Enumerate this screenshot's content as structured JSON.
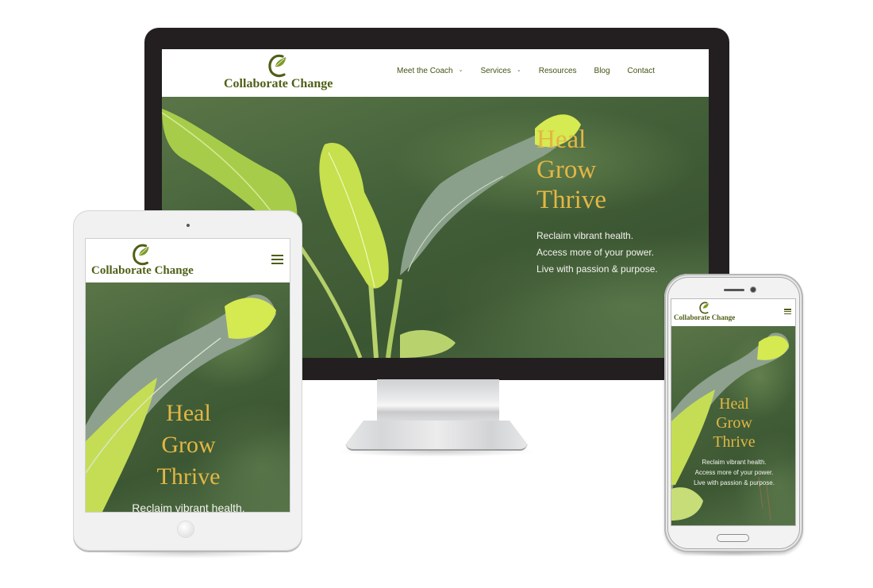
{
  "site": {
    "brand_name": "Collaborate Change",
    "logo_icon": "leaf-c-monogram-icon",
    "brand_color": "#4f5f17",
    "accent_color": "#e2b744"
  },
  "desktop": {
    "nav": [
      {
        "label": "Meet the Coach",
        "has_dropdown": true,
        "icon": "chevron-down-icon",
        "chev": "⌄"
      },
      {
        "label": "Services",
        "has_dropdown": true,
        "icon": "chevron-down-icon",
        "chev": "⌄"
      },
      {
        "label": "Resources",
        "has_dropdown": false
      },
      {
        "label": "Blog",
        "has_dropdown": false
      },
      {
        "label": "Contact",
        "has_dropdown": false
      }
    ]
  },
  "mobile": {
    "menu_icon": "hamburger-menu-icon"
  },
  "hero": {
    "headline": [
      "Heal",
      "Grow",
      "Thrive"
    ],
    "taglines": [
      "Reclaim vibrant health.",
      "Access more of your power.",
      "Live with passion & purpose."
    ],
    "tablet_visible_taglines": [
      "Reclaim vibrant health."
    ]
  }
}
